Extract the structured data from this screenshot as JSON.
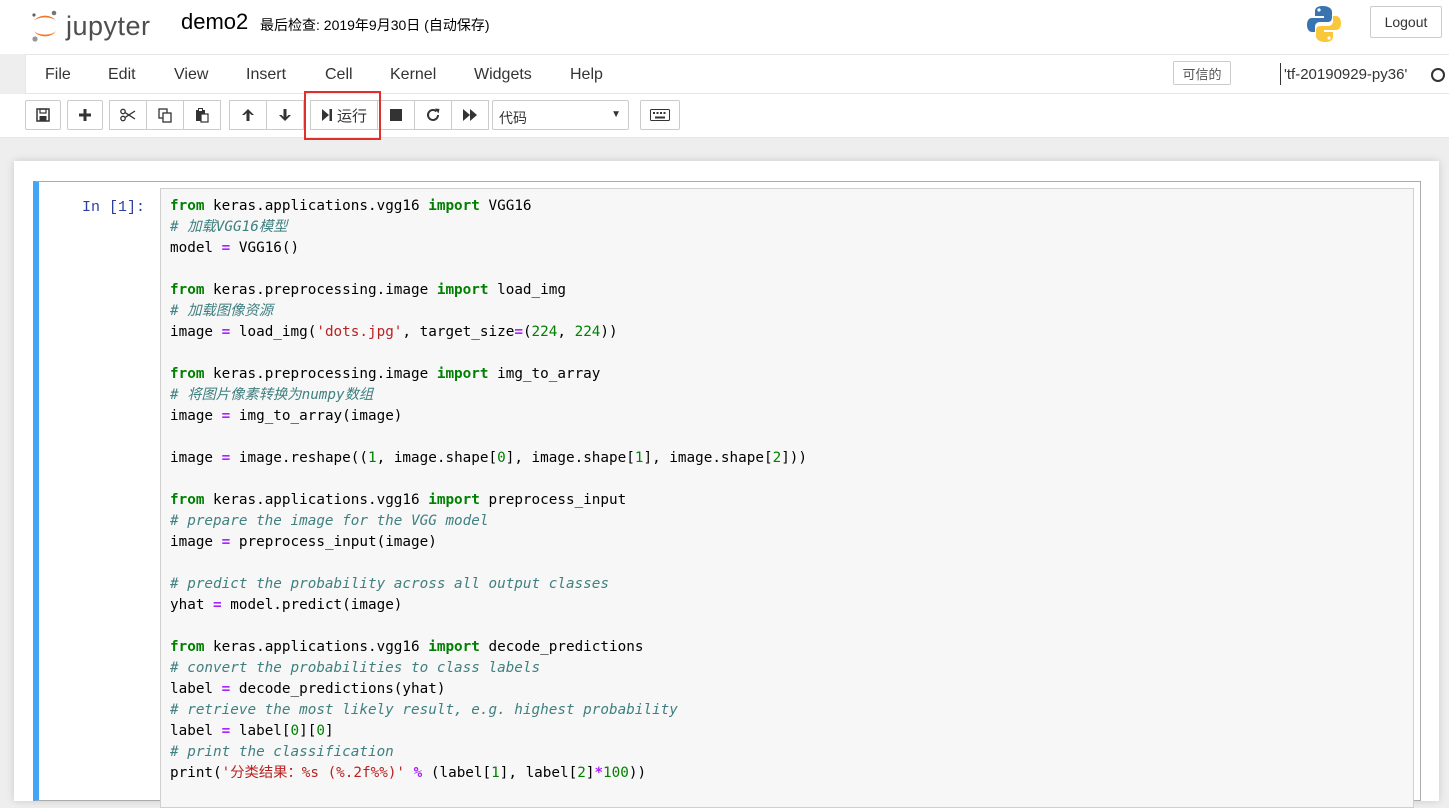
{
  "header": {
    "brand": "jupyter",
    "notebook_name": "demo2",
    "checkpoint": "最后检查: 2019年9月30日  (自动保存)",
    "logout_label": "Logout"
  },
  "menubar": {
    "items": [
      "File",
      "Edit",
      "View",
      "Insert",
      "Cell",
      "Kernel",
      "Widgets",
      "Help"
    ],
    "trusted_label": "可信的",
    "kernel_name": "'tf-20190929-py36'"
  },
  "toolbar": {
    "run_label": "运行",
    "cell_type": "代码"
  },
  "cell": {
    "prompt": "In  [1]:",
    "code_lines": [
      [
        [
          "kw",
          "from"
        ],
        [
          "pl",
          " keras.applications.vgg16 "
        ],
        [
          "kw",
          "import"
        ],
        [
          "pl",
          " VGG16"
        ]
      ],
      [
        [
          "cm",
          "# 加载VGG16模型"
        ]
      ],
      [
        [
          "pl",
          "model "
        ],
        [
          "op",
          "="
        ],
        [
          "pl",
          " VGG16()"
        ]
      ],
      [],
      [
        [
          "kw",
          "from"
        ],
        [
          "pl",
          " keras.preprocessing.image "
        ],
        [
          "kw",
          "import"
        ],
        [
          "pl",
          " load_img"
        ]
      ],
      [
        [
          "cm",
          "# 加载图像资源"
        ]
      ],
      [
        [
          "pl",
          "image "
        ],
        [
          "op",
          "="
        ],
        [
          "pl",
          " load_img("
        ],
        [
          "st",
          "'dots.jpg'"
        ],
        [
          "pl",
          ", target_size"
        ],
        [
          "op",
          "="
        ],
        [
          "pl",
          "("
        ],
        [
          "nu",
          "224"
        ],
        [
          "pl",
          ", "
        ],
        [
          "nu",
          "224"
        ],
        [
          "pl",
          "))"
        ]
      ],
      [],
      [
        [
          "kw",
          "from"
        ],
        [
          "pl",
          " keras.preprocessing.image "
        ],
        [
          "kw",
          "import"
        ],
        [
          "pl",
          " img_to_array"
        ]
      ],
      [
        [
          "cm",
          "# 将图片像素转换为numpy数组"
        ]
      ],
      [
        [
          "pl",
          "image "
        ],
        [
          "op",
          "="
        ],
        [
          "pl",
          " img_to_array(image)"
        ]
      ],
      [],
      [
        [
          "pl",
          "image "
        ],
        [
          "op",
          "="
        ],
        [
          "pl",
          " image.reshape(("
        ],
        [
          "nu",
          "1"
        ],
        [
          "pl",
          ", image.shape["
        ],
        [
          "nu",
          "0"
        ],
        [
          "pl",
          "], image.shape["
        ],
        [
          "nu",
          "1"
        ],
        [
          "pl",
          "], image.shape["
        ],
        [
          "nu",
          "2"
        ],
        [
          "pl",
          "]))"
        ]
      ],
      [],
      [
        [
          "kw",
          "from"
        ],
        [
          "pl",
          " keras.applications.vgg16 "
        ],
        [
          "kw",
          "import"
        ],
        [
          "pl",
          " preprocess_input"
        ]
      ],
      [
        [
          "cm",
          "# prepare the image for the VGG model"
        ]
      ],
      [
        [
          "pl",
          "image "
        ],
        [
          "op",
          "="
        ],
        [
          "pl",
          " preprocess_input(image)"
        ]
      ],
      [],
      [
        [
          "cm",
          "# predict the probability across all output classes"
        ]
      ],
      [
        [
          "pl",
          "yhat "
        ],
        [
          "op",
          "="
        ],
        [
          "pl",
          " model.predict(image)"
        ]
      ],
      [],
      [
        [
          "kw",
          "from"
        ],
        [
          "pl",
          " keras.applications.vgg16 "
        ],
        [
          "kw",
          "import"
        ],
        [
          "pl",
          " decode_predictions"
        ]
      ],
      [
        [
          "cm",
          "# convert the probabilities to class labels"
        ]
      ],
      [
        [
          "pl",
          "label "
        ],
        [
          "op",
          "="
        ],
        [
          "pl",
          " decode_predictions(yhat)"
        ]
      ],
      [
        [
          "cm",
          "# retrieve the most likely result, e.g. highest probability"
        ]
      ],
      [
        [
          "pl",
          "label "
        ],
        [
          "op",
          "="
        ],
        [
          "pl",
          " label["
        ],
        [
          "nu",
          "0"
        ],
        [
          "pl",
          "]["
        ],
        [
          "nu",
          "0"
        ],
        [
          "pl",
          "]"
        ]
      ],
      [
        [
          "cm",
          "# print the classification"
        ]
      ],
      [
        [
          "pl",
          "print("
        ],
        [
          "st",
          "'分类结果：%s (%.2f%%)'"
        ],
        [
          "pl",
          " "
        ],
        [
          "op",
          "%"
        ],
        [
          "pl",
          " (label["
        ],
        [
          "nu",
          "1"
        ],
        [
          "pl",
          "], label["
        ],
        [
          "nu",
          "2"
        ],
        [
          "pl",
          "]"
        ],
        [
          "op",
          "*"
        ],
        [
          "nu",
          "100"
        ],
        [
          "pl",
          "))"
        ]
      ]
    ]
  }
}
